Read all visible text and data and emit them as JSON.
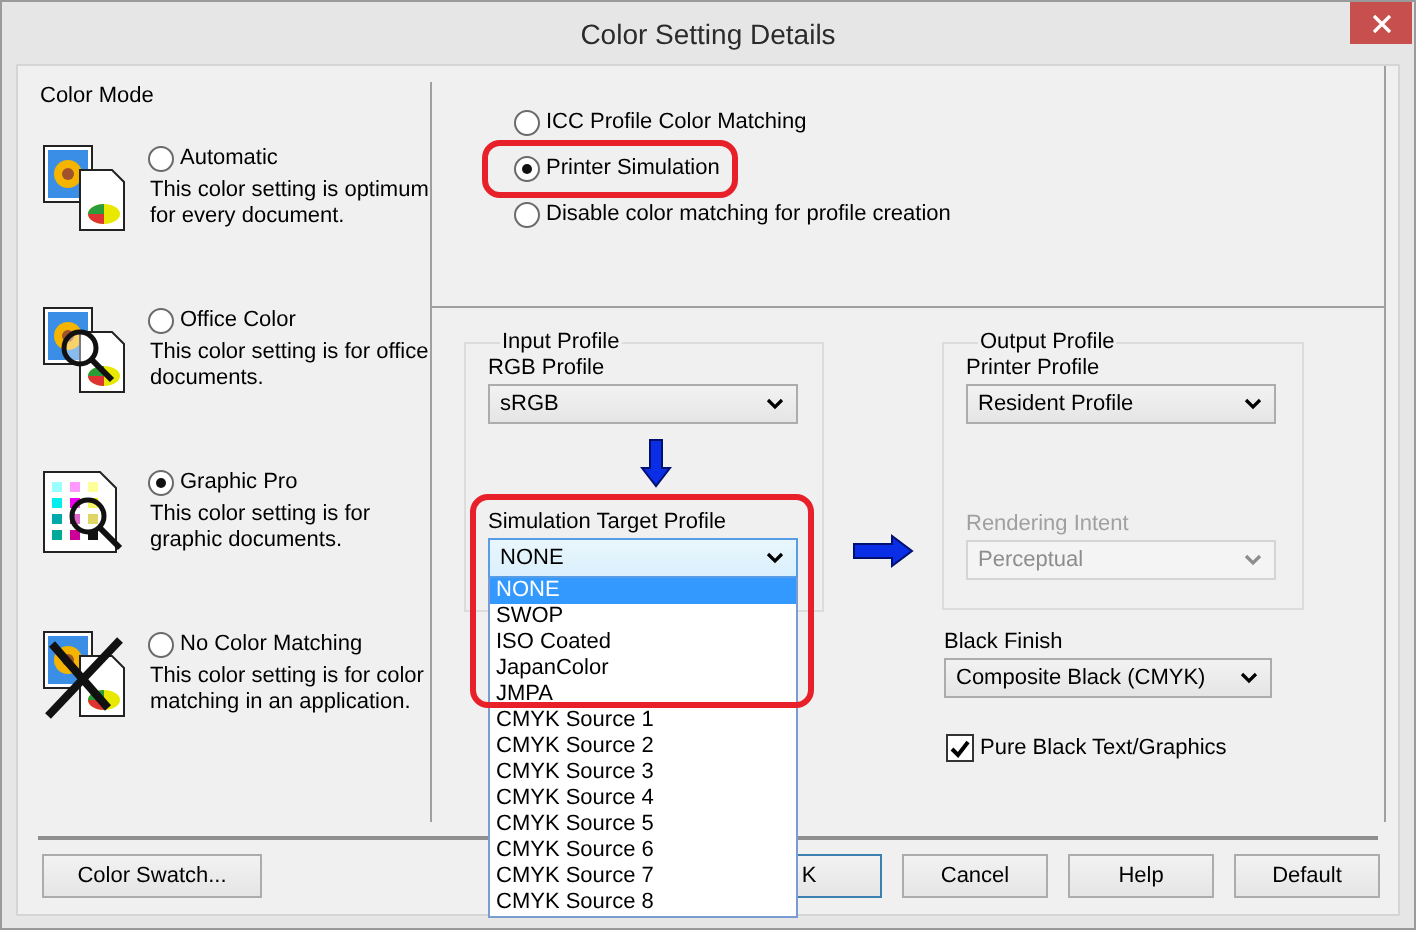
{
  "window": {
    "title": "Color Setting Details"
  },
  "color_mode": {
    "label": "Color Mode",
    "options": [
      {
        "kind": "automatic",
        "label": "Automatic",
        "description": "This color setting is optimum\nfor every document.",
        "selected": false
      },
      {
        "kind": "office",
        "label": "Office Color",
        "description": "This color setting is for office\ndocuments.",
        "selected": false
      },
      {
        "kind": "graphic",
        "label": "Graphic Pro",
        "description": "This color setting is for\ngraphic documents.",
        "selected": true
      },
      {
        "kind": "nomatch",
        "label": "No Color Matching",
        "description": "This color setting is for color\nmatching in an application.",
        "selected": false
      }
    ]
  },
  "color_matching": {
    "options": [
      {
        "label": "ICC Profile Color Matching",
        "selected": false,
        "highlighted": false
      },
      {
        "label": "Printer Simulation",
        "selected": true,
        "highlighted": true
      },
      {
        "label": "Disable color matching for profile creation",
        "selected": false,
        "highlighted": false
      }
    ]
  },
  "input_profile": {
    "title": "Input Profile",
    "rgb_profile": {
      "label": "RGB Profile",
      "value": "sRGB"
    },
    "simulation_target": {
      "label": "Simulation Target Profile",
      "value": "NONE",
      "expanded": true,
      "highlighted": true,
      "options": [
        {
          "label": "NONE",
          "selected": true
        },
        {
          "label": "SWOP",
          "selected": false
        },
        {
          "label": "ISO Coated",
          "selected": false
        },
        {
          "label": "JapanColor",
          "selected": false
        },
        {
          "label": "JMPA",
          "selected": false
        },
        {
          "label": "CMYK Source 1",
          "selected": false
        },
        {
          "label": "CMYK Source 2",
          "selected": false
        },
        {
          "label": "CMYK Source 3",
          "selected": false
        },
        {
          "label": "CMYK Source 4",
          "selected": false
        },
        {
          "label": "CMYK Source 5",
          "selected": false
        },
        {
          "label": "CMYK Source 6",
          "selected": false
        },
        {
          "label": "CMYK Source 7",
          "selected": false
        },
        {
          "label": "CMYK Source 8",
          "selected": false
        }
      ]
    }
  },
  "output_profile": {
    "title": "Output Profile",
    "printer_profile": {
      "label": "Printer Profile",
      "value": "Resident Profile",
      "disabled": false
    },
    "rendering_intent": {
      "label": "Rendering Intent",
      "value": "Perceptual",
      "disabled": true
    }
  },
  "black_finish": {
    "label": "Black Finish",
    "value": "Composite Black (CMYK)"
  },
  "pure_black": {
    "label": "Pure Black Text/Graphics",
    "checked": true
  },
  "buttons": [
    {
      "label": "Color Swatch..."
    },
    {
      "label": "K"
    },
    {
      "label": "Cancel"
    },
    {
      "label": "Help"
    },
    {
      "label": "Default"
    }
  ]
}
